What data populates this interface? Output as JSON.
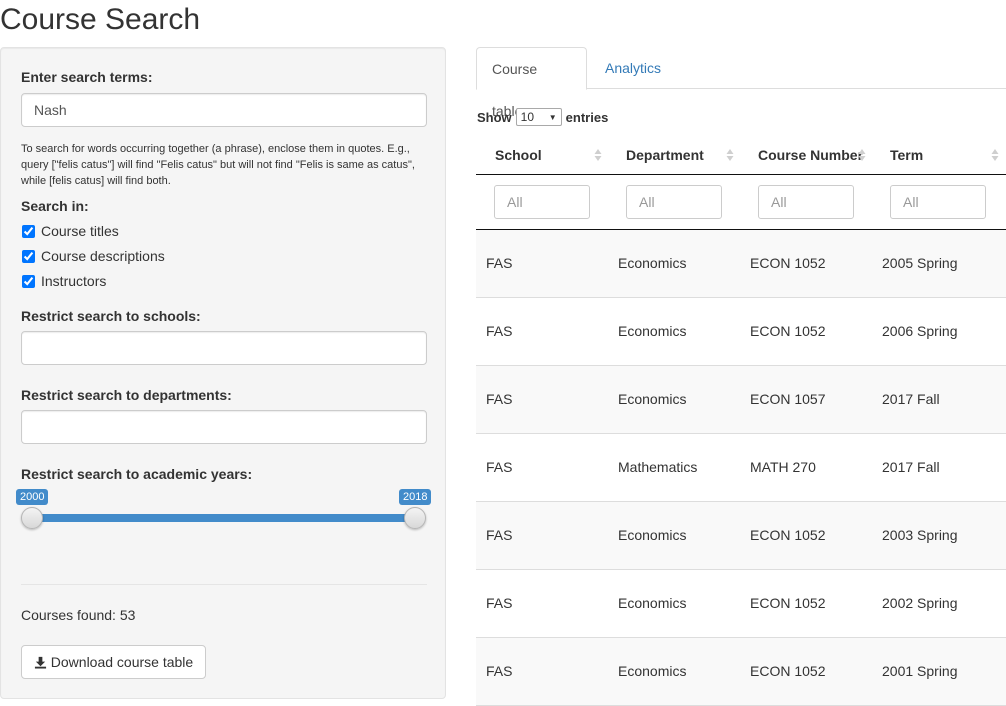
{
  "page": {
    "title": "Course Search"
  },
  "sidebar": {
    "search_label": "Enter search terms:",
    "search_value": "Nash",
    "help_text": "To search for words occurring together (a phrase), enclose them in quotes. E.g., query [\"felis catus\"] will find \"Felis catus\" but will not find \"Felis is same as catus\", while [felis catus] will find both.",
    "search_in_label": "Search in:",
    "checkboxes": [
      {
        "label": "Course titles",
        "checked": true
      },
      {
        "label": "Course descriptions",
        "checked": true
      },
      {
        "label": "Instructors",
        "checked": true
      }
    ],
    "schools_label": "Restrict search to schools:",
    "departments_label": "Restrict search to departments:",
    "years_label": "Restrict search to academic years:",
    "year_slider": {
      "min": "2000",
      "max": "2018",
      "from": 2000,
      "to": 2018,
      "color": "#428bca"
    },
    "courses_found": "Courses found: 53",
    "download_label": "Download course table",
    "download_icon": "download-icon"
  },
  "tabs": [
    {
      "label": "Course table",
      "active": true
    },
    {
      "label": "Analytics",
      "active": false
    }
  ],
  "table": {
    "show_label": "Show",
    "entries_value": "10",
    "entries_label": "entries",
    "columns": [
      "School",
      "Department",
      "Course Number",
      "Term"
    ],
    "filter_placeholder": "All",
    "rows": [
      [
        "FAS",
        "Economics",
        "ECON 1052",
        "2005 Spring"
      ],
      [
        "FAS",
        "Economics",
        "ECON 1052",
        "2006 Spring"
      ],
      [
        "FAS",
        "Economics",
        "ECON 1057",
        "2017 Fall"
      ],
      [
        "FAS",
        "Mathematics",
        "MATH 270",
        "2017 Fall"
      ],
      [
        "FAS",
        "Economics",
        "ECON 1052",
        "2003 Spring"
      ],
      [
        "FAS",
        "Economics",
        "ECON 1052",
        "2002 Spring"
      ],
      [
        "FAS",
        "Economics",
        "ECON 1052",
        "2001 Spring"
      ]
    ]
  },
  "colors": {
    "accent": "#428bca",
    "link": "#337ab7"
  }
}
